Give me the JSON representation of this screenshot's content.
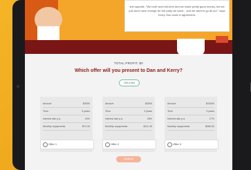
{
  "story": {
    "speech_text": "she squeals. \"We both work full-time and we make pretty good money, but we just don't have enough for the party we want... and we want to go all out,\" says Kerry. Dan nods in agreement."
  },
  "header": {
    "total_profit": "TOTAL PROFIT: $0",
    "question": "Which offer will you present to Dan and Kerry?",
    "hint_label": "Get a hint"
  },
  "offers": [
    {
      "rows": [
        {
          "label": "Amount",
          "value": "$3000"
        },
        {
          "label": "Term",
          "value": "3 years"
        },
        {
          "label": "Interest rate p.a.",
          "value": "20%"
        },
        {
          "label": "Monthly repayments",
          "value": "$74.33"
        }
      ],
      "option_label": "Offer 1"
    },
    {
      "rows": [
        {
          "label": "Amount",
          "value": "$3500"
        },
        {
          "label": "Term",
          "value": "3 years"
        },
        {
          "label": "Interest rate p.a.",
          "value": "28%"
        },
        {
          "label": "Monthly repayments",
          "value": "$111.49"
        }
      ],
      "option_label": "Offer 2"
    },
    {
      "rows": [
        {
          "label": "Amount",
          "value": "$10000"
        },
        {
          "label": "Term",
          "value": "3 years"
        },
        {
          "label": "Interest rate p.a.",
          "value": "17%"
        },
        {
          "label": "Monthly repayments",
          "value": "$356.53"
        }
      ],
      "option_label": "Offer 3"
    }
  ],
  "footer": {
    "continue_label": "Continue"
  }
}
